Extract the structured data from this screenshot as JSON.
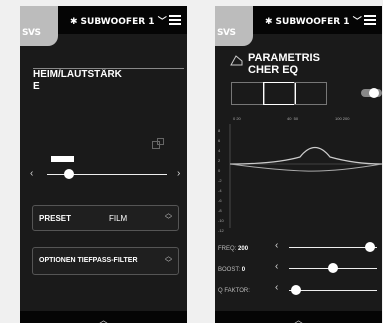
{
  "brand": {
    "logo_text": "SVS"
  },
  "left": {
    "device_name": "SUBWOOFER 1",
    "title_line1": "HEIM/LAUTSTÄRK",
    "title_line2": "E",
    "preset_label": "PRESET",
    "preset_value": "FILM",
    "option_label": "OPTIONEN TIEFPASS-FILTER",
    "volume_level": 0.18
  },
  "right": {
    "device_name": "SUBWOOFER 1",
    "title_line1": "PARAMETRIS",
    "title_line2": "CHER EQ",
    "freq_axis": [
      "0 20",
      "40  50",
      "100 200"
    ],
    "y_axis": [
      "8",
      "6",
      "4",
      "2",
      "0",
      "-2",
      "-4",
      "-6",
      "-8",
      "-10",
      "-12"
    ],
    "freq_label": "FREQ:",
    "freq_value": "200",
    "boost_label": "BOOST:",
    "boost_value": "0",
    "q_label": "Q FAKTOR:",
    "freq_level": 0.92,
    "boost_level": 0.5,
    "q_level": 0.08
  },
  "colors": {
    "background": "#1a1a1a",
    "bar": "#050505",
    "logo": "#bcbcbc"
  }
}
